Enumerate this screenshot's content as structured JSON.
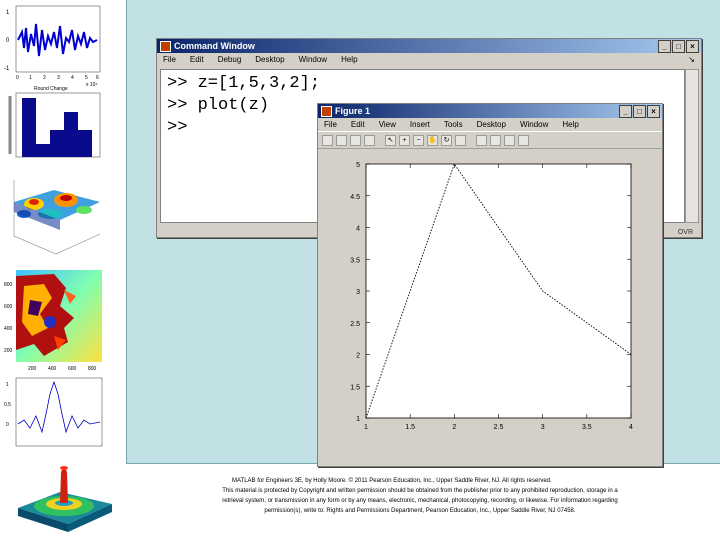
{
  "command_window": {
    "title": "Command Window",
    "menu": [
      "File",
      "Edit",
      "Debug",
      "Desktop",
      "Window",
      "Help"
    ],
    "menu_arrow": "↘",
    "lines": [
      ">> z=[1,5,3,2];",
      ">> plot(z)",
      ">>"
    ],
    "status": "OVR"
  },
  "figure_window": {
    "title": "Figure 1",
    "menu": [
      "File",
      "Edit",
      "View",
      "Insert",
      "Tools",
      "Desktop",
      "Window",
      "Help"
    ]
  },
  "chart_data": {
    "type": "line",
    "x": [
      1,
      2,
      3,
      4
    ],
    "y": [
      1,
      5,
      3,
      2
    ],
    "xlim": [
      1,
      4
    ],
    "ylim": [
      1,
      5
    ],
    "xticks": [
      "1",
      "1.5",
      "2",
      "2.5",
      "3",
      "3.5",
      "4"
    ],
    "yticks": [
      "1",
      "1.5",
      "2",
      "2.5",
      "3",
      "3.5",
      "4",
      "4.5",
      "5"
    ],
    "line_color": "#000000",
    "line_style": "dotted"
  },
  "thumb_labels": {
    "t1_y": [
      "1",
      "0",
      "-1"
    ],
    "t1_x": [
      "0",
      "1",
      "2",
      "3",
      "4",
      "5",
      "6"
    ],
    "t1_x_unit": "x 10⁴",
    "t2_title": "Round Change",
    "t4_y": [
      "800",
      "600",
      "400",
      "200"
    ],
    "t4_x": [
      "200",
      "400",
      "600",
      "800"
    ],
    "t5_y": [
      "1",
      "0.5",
      "0"
    ]
  },
  "footer": {
    "line1": "MATLAB for Engineers 3E, by Holly Moore. © 2011 Pearson Education, Inc., Upper Saddle River, NJ. All rights reserved.",
    "line2": "This material is protected by Copyright and written permission should be obtained from the publisher prior to any prohibited reproduction, storage in a",
    "line3": "retrieval system, or transmission in any form or by any means, electronic, mechanical, photocopying, recording, or likewise. For information regarding",
    "line4": "permission(s), write to: Rights and Permissions Department, Pearson Education, Inc., Upper Saddle River, NJ 07458."
  },
  "colors": {
    "background": "#c1e1e5",
    "titlebar": "#0a246a",
    "window": "#d4d0c8"
  }
}
